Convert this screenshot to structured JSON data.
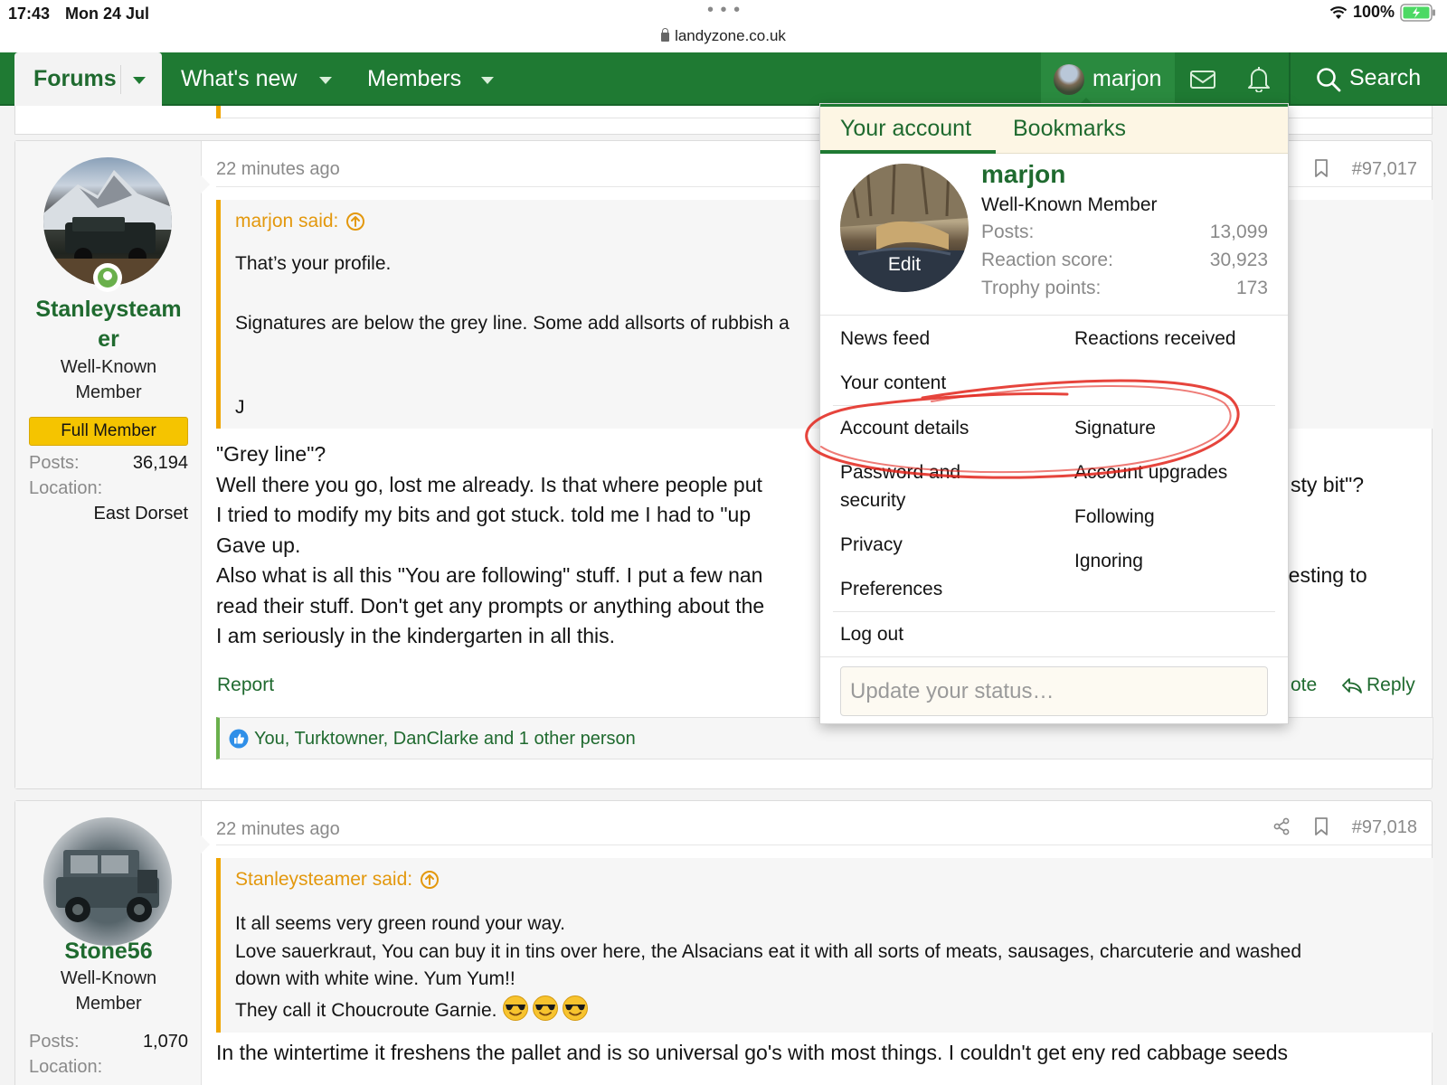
{
  "status_bar": {
    "time": "17:43",
    "date": "Mon 24 Jul",
    "url": "landyzone.co.uk",
    "battery": "100%"
  },
  "nav": {
    "forums": "Forums",
    "whats_new": "What's new",
    "members": "Members",
    "username": "marjon",
    "search": "Search"
  },
  "post1": {
    "time": "22 minutes ago",
    "number": "#97,017",
    "user": {
      "name_line1": "Stanleysteam",
      "name_line2": "er",
      "title_line1": "Well-Known",
      "title_line2": "Member",
      "badge": "Full Member",
      "posts_label": "Posts:",
      "posts_value": "36,194",
      "location_label": "Location:",
      "location_value": "East Dorset"
    },
    "quote": {
      "author": "marjon said:",
      "lines": [
        "That’s your profile.",
        "Signatures are below the grey line. Some add allsorts of rubbish a",
        "J"
      ]
    },
    "body": [
      "\"Grey line\"?",
      "Well there you go, lost me already. Is that where people put",
      "I tried to modify my bits and got stuck. told me I had to \"up",
      "Gave up.",
      "Also what is all this \"You are following\" stuff. I put a few nan",
      "read their stuff. Don't get any prompts or anything about the",
      "I am seriously in the kindergarten in all this."
    ],
    "body_overflow": {
      "line2": "sty bit\"?",
      "line5": "resting to"
    },
    "report": "Report",
    "quote_action": "ote",
    "reply": "Reply",
    "reactions": "You, Turktowner, DanClarke and 1 other person"
  },
  "post2": {
    "time": "22 minutes ago",
    "number": "#97,018",
    "user": {
      "name": "Stone56",
      "title_line1": "Well-Known",
      "title_line2": "Member",
      "posts_label": "Posts:",
      "posts_value": "1,070",
      "location_label": "Location:"
    },
    "quote": {
      "author": "Stanleysteamer said:",
      "lines": [
        "It all seems very green round your way.",
        "Love sauerkraut, You can buy it in tins over here, the Alsacians eat it with all sorts of meats, sausages, charcuterie and washed",
        "down with white wine. Yum Yum!!",
        "They call it Choucroute Garnie."
      ]
    },
    "body": [
      "In the wintertime it freshens the pallet and is so universal go's with most things. I couldn't get eny red cabbage seeds"
    ]
  },
  "menu": {
    "tab_account": "Your account",
    "tab_bookmarks": "Bookmarks",
    "avatar_edit": "Edit",
    "name": "marjon",
    "title": "Well-Known Member",
    "stats": [
      {
        "label": "Posts:",
        "value": "13,099"
      },
      {
        "label": "Reaction score:",
        "value": "30,923"
      },
      {
        "label": "Trophy points:",
        "value": "173"
      }
    ],
    "links": {
      "news_feed": "News feed",
      "reactions_received": "Reactions received",
      "your_content": "Your content",
      "account_details": "Account details",
      "signature": "Signature",
      "password_security_1": "Password and",
      "password_security_2": "security",
      "account_upgrades": "Account upgrades",
      "following": "Following",
      "privacy": "Privacy",
      "ignoring": "Ignoring",
      "preferences": "Preferences",
      "log_out": "Log out"
    },
    "status_placeholder": "Update your status…"
  },
  "colors": {
    "brand_green": "#1f7a33",
    "link_green": "#1f6a2f",
    "quote_orange": "#f0a500",
    "badge_yellow": "#f5c400",
    "annotation_red": "#e2231a"
  },
  "icons": [
    "wifi-icon",
    "battery-icon",
    "caret-down-icon",
    "mail-icon",
    "bell-icon",
    "search-icon",
    "bookmark-icon",
    "share-icon",
    "arrow-up-circle-icon",
    "reply-icon",
    "like-icon",
    "cool-emoji-icon"
  ]
}
